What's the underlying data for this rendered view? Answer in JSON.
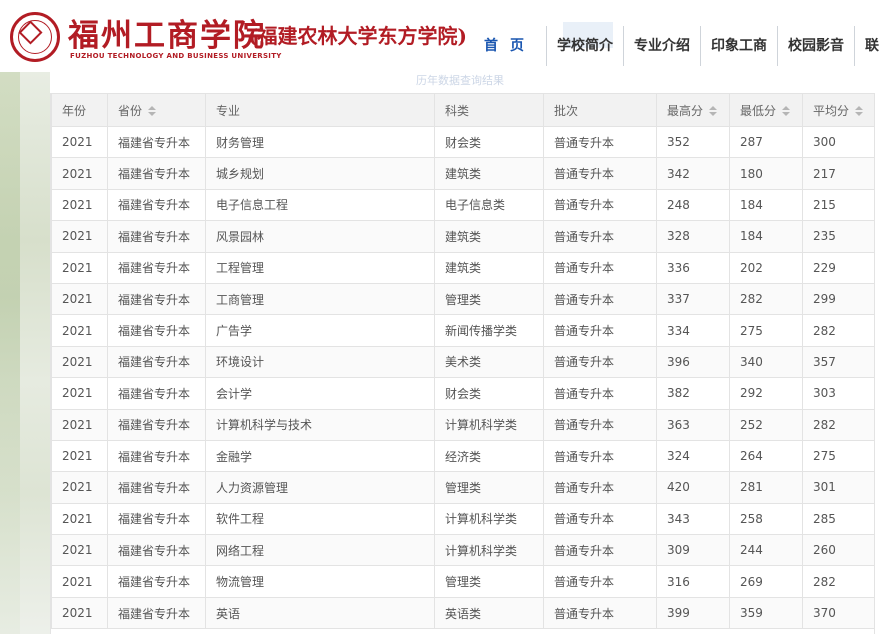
{
  "header": {
    "school_name_zh": "福州工商学院",
    "school_name_former": "(福建农林大学东方学院)",
    "school_name_en": "FUZHOU TECHNOLOGY AND BUSINESS UNIVERSITY",
    "nav": [
      "首页",
      "学校简介",
      "专业介绍",
      "印象工商",
      "校园影音",
      "联系"
    ],
    "watermark": "历年数据查询结果"
  },
  "table": {
    "columns": [
      {
        "label": "年份",
        "sortable": false
      },
      {
        "label": "省份",
        "sortable": true
      },
      {
        "label": "专业",
        "sortable": false
      },
      {
        "label": "科类",
        "sortable": false
      },
      {
        "label": "批次",
        "sortable": false
      },
      {
        "label": "最高分",
        "sortable": true
      },
      {
        "label": "最低分",
        "sortable": true
      },
      {
        "label": "平均分",
        "sortable": true
      }
    ],
    "rows": [
      [
        "2021",
        "福建省专升本",
        "财务管理",
        "财会类",
        "普通专升本",
        "352",
        "287",
        "300"
      ],
      [
        "2021",
        "福建省专升本",
        "城乡规划",
        "建筑类",
        "普通专升本",
        "342",
        "180",
        "217"
      ],
      [
        "2021",
        "福建省专升本",
        "电子信息工程",
        "电子信息类",
        "普通专升本",
        "248",
        "184",
        "215"
      ],
      [
        "2021",
        "福建省专升本",
        "风景园林",
        "建筑类",
        "普通专升本",
        "328",
        "184",
        "235"
      ],
      [
        "2021",
        "福建省专升本",
        "工程管理",
        "建筑类",
        "普通专升本",
        "336",
        "202",
        "229"
      ],
      [
        "2021",
        "福建省专升本",
        "工商管理",
        "管理类",
        "普通专升本",
        "337",
        "282",
        "299"
      ],
      [
        "2021",
        "福建省专升本",
        "广告学",
        "新闻传播学类",
        "普通专升本",
        "334",
        "275",
        "282"
      ],
      [
        "2021",
        "福建省专升本",
        "环境设计",
        "美术类",
        "普通专升本",
        "396",
        "340",
        "357"
      ],
      [
        "2021",
        "福建省专升本",
        "会计学",
        "财会类",
        "普通专升本",
        "382",
        "292",
        "303"
      ],
      [
        "2021",
        "福建省专升本",
        "计算机科学与技术",
        "计算机科学类",
        "普通专升本",
        "363",
        "252",
        "282"
      ],
      [
        "2021",
        "福建省专升本",
        "金融学",
        "经济类",
        "普通专升本",
        "324",
        "264",
        "275"
      ],
      [
        "2021",
        "福建省专升本",
        "人力资源管理",
        "管理类",
        "普通专升本",
        "420",
        "281",
        "301"
      ],
      [
        "2021",
        "福建省专升本",
        "软件工程",
        "计算机科学类",
        "普通专升本",
        "343",
        "258",
        "285"
      ],
      [
        "2021",
        "福建省专升本",
        "网络工程",
        "计算机科学类",
        "普通专升本",
        "309",
        "244",
        "260"
      ],
      [
        "2021",
        "福建省专升本",
        "物流管理",
        "管理类",
        "普通专升本",
        "316",
        "269",
        "282"
      ],
      [
        "2021",
        "福建省专升本",
        "英语",
        "英语类",
        "普通专升本",
        "399",
        "359",
        "370"
      ]
    ]
  },
  "colors": {
    "brand_red": "#b21c24",
    "nav_active": "#1a56b0",
    "header_bg": "#f2f2f2"
  }
}
